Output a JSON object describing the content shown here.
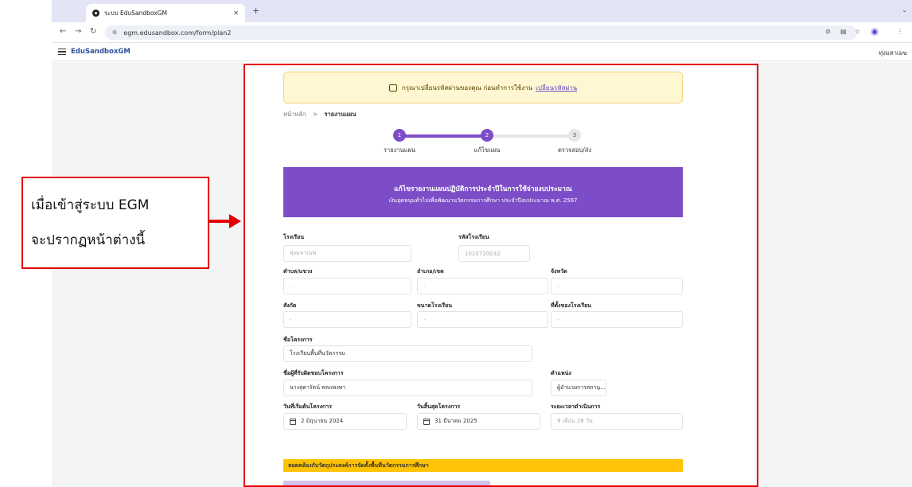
{
  "browser": {
    "tab_title": "ระบบ EduSandboxGM",
    "url": "egm.edusandbox.com/form/plan2",
    "icons": [
      "back-icon",
      "forward-icon",
      "reload-icon",
      "site-info-icon",
      "eye-off-icon",
      "translate-icon",
      "star-icon",
      "profile-icon",
      "menu-icon"
    ]
  },
  "appbar": {
    "brand": "EduSandboxGM",
    "user": "ทุ่งมหาเมฆ"
  },
  "alert": {
    "message": "กรุณาเปลี่ยนรหัสผ่านของคุณ ก่อนทำการใช้งาน",
    "link": "เปลี่ยนรหัสผ่าน"
  },
  "breadcrumb": {
    "home": "หน้าหลัก",
    "sep": ">",
    "current": "รายงานแผน"
  },
  "steps": [
    {
      "num": "1",
      "label": "รายงานแผน",
      "state": "done"
    },
    {
      "num": "2",
      "label": "แก้ไขแผน",
      "state": "active"
    },
    {
      "num": "3",
      "label": "ตรวจสอบ/ส่ง",
      "state": "todo"
    }
  ],
  "banner": {
    "title": "แก้ไขรายงานแผนปฏิบัติการประจำปีในการใช้จ่ายงบประมาณ",
    "subtitle": "เงินอุดหนุนทั่วไปเพื่อพัฒนานวัตกรรมการศึกษา ประจำปีงบประมาณ พ.ศ. 2567"
  },
  "form": {
    "school": {
      "label": "โรงเรียน",
      "value": "ทุ่งมหาเมฆ"
    },
    "school_code": {
      "label": "รหัสโรงเรียน",
      "value": "1010720032"
    },
    "subdistrict": {
      "label": "ตำบล/แขวง",
      "value": "-"
    },
    "district": {
      "label": "อำเภอ/เขต",
      "value": "-"
    },
    "province": {
      "label": "จังหวัด",
      "value": "-"
    },
    "affiliation": {
      "label": "สังกัด",
      "value": "-"
    },
    "school_size": {
      "label": "ขนาดโรงเรียน",
      "value": "-"
    },
    "location": {
      "label": "ที่ตั้งของโรงเรียน",
      "value": "-"
    },
    "project_name": {
      "label": "ชื่อโครงการ",
      "value": "โรงเรียนพื้นที่นวัตกรรม"
    },
    "owner": {
      "label": "ชื่อผู้ที่รับผิดชอบโครงการ",
      "value": "นางสุดารัตน์ พลแพงพา"
    },
    "position": {
      "label": "ตำแหน่ง",
      "value": "ผู้อำนวยการสถาน..."
    },
    "start_date": {
      "label": "วันที่เริ่มต้นโครงการ",
      "value": "2 มิถุนายน 2024"
    },
    "end_date": {
      "label": "วันสิ้นสุดโครงการ",
      "value": "31 มีนาคม 2025"
    },
    "duration": {
      "label": "ระยะเวลาดำเนินการ",
      "value": "9 เดือน 28 วัน"
    }
  },
  "section_bar": "สอดคล้องกับวัตถุประสงค์การจัดตั้งพื้นที่นวัตกรรมการศึกษา",
  "annotation": {
    "line1": "เมื่อเข้าสู่ระบบ EGM",
    "line2": "จะปรากฏหน้าต่างนี้"
  },
  "colors": {
    "accent": "#7c4dc7",
    "highlight": "#e30000",
    "section": "#fec306",
    "alert_bg": "#fff7d1"
  }
}
